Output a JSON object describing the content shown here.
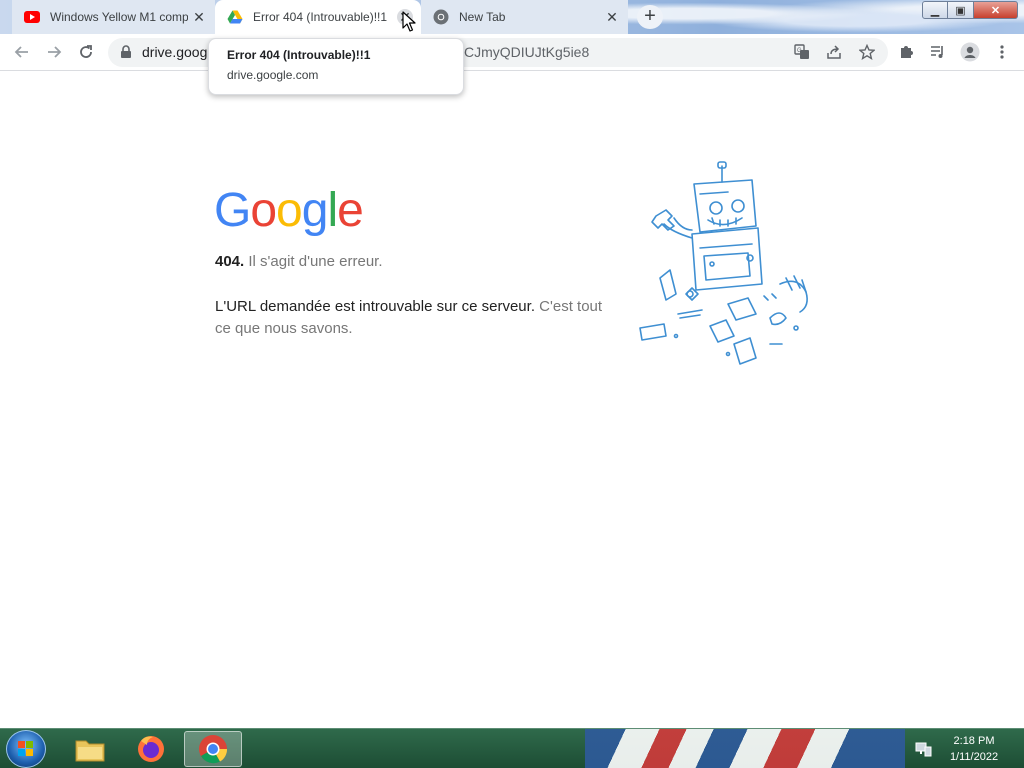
{
  "tabs": [
    {
      "title": "Windows Yellow M1 comp",
      "favicon": "youtube-icon",
      "active": false
    },
    {
      "title": "Error 404 (Introuvable)!!1",
      "favicon": "google-drive-icon",
      "active": true
    },
    {
      "title": "New Tab",
      "favicon": "chrome-icon",
      "active": false
    }
  ],
  "toolbar": {
    "url_visible": "drive.goog",
    "url_tail": "CJmyQDIUJtKg5ie8"
  },
  "tooltip": {
    "title": "Error 404 (Introuvable)!!1",
    "domain": "drive.google.com"
  },
  "page": {
    "logo": [
      "G",
      "o",
      "o",
      "g",
      "l",
      "e"
    ],
    "code": "404.",
    "code_message": "Il s'agit d'une erreur.",
    "description": "L'URL demandée est introuvable sur ce serveur.",
    "description_muted": "C'est tout ce que nous savons."
  },
  "taskbar": {
    "time": "2:18 PM",
    "date": "1/11/2022",
    "apps": [
      "file-explorer-icon",
      "firefox-icon",
      "chrome-icon"
    ]
  },
  "colors": {
    "google_blue": "#4285F4",
    "google_red": "#EA4335",
    "google_yellow": "#FBBC05",
    "google_green": "#34A853",
    "robot_stroke": "#3f8fd2"
  }
}
